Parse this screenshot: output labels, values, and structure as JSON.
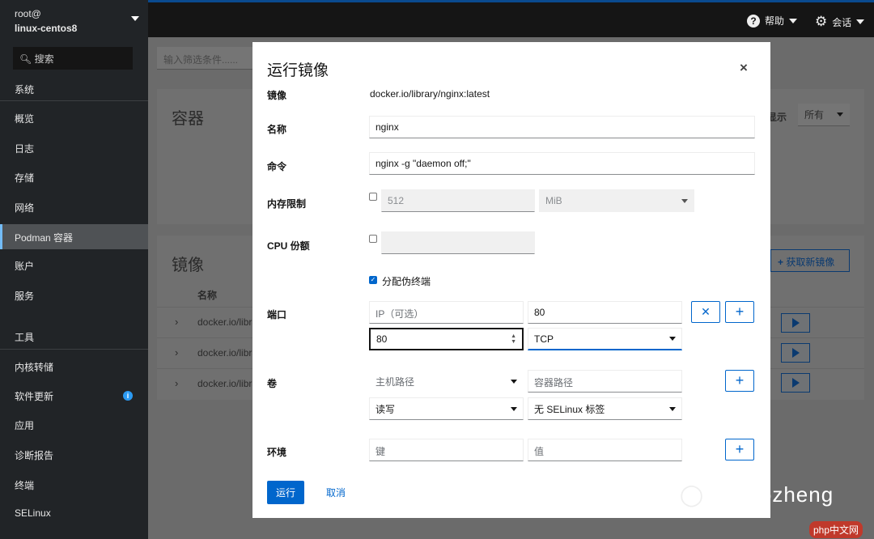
{
  "sidebar": {
    "user": "root@",
    "host": "linux-centos8",
    "search": "搜索",
    "section_system": "系统",
    "items_system": [
      "概览",
      "日志",
      "存储",
      "网络",
      "Podman 容器",
      "账户",
      "服务"
    ],
    "section_tools": "工具",
    "items_tools": [
      "内核转储",
      "软件更新",
      "应用",
      "诊断报告",
      "终端",
      "SELinux"
    ]
  },
  "topbar": {
    "help": "帮助",
    "session": "会话"
  },
  "background": {
    "filter_placeholder": "输入筛选条件......",
    "containers_title": "容器",
    "show_label": "显示",
    "show_value": "所有",
    "images_title": "镜像",
    "get_image": "获取新镜像",
    "name_header": "名称",
    "rows": [
      "docker.io/libra",
      "docker.io/libra",
      "docker.io/libra"
    ]
  },
  "modal": {
    "title": "运行镜像",
    "image_label": "镜像",
    "image_value": "docker.io/library/nginx:latest",
    "name_label": "名称",
    "name_value": "nginx",
    "command_label": "命令",
    "command_value": "nginx -g \"daemon off;\"",
    "memory_label": "内存限制",
    "memory_value": "512",
    "memory_unit": "MiB",
    "cpu_label": "CPU 份额",
    "tty_label": "分配伪终端",
    "ports_label": "端口",
    "ip_placeholder": "IP（可选）",
    "container_port": "80",
    "host_port": "80",
    "protocol": "TCP",
    "volumes_label": "卷",
    "host_path_placeholder": "主机路径",
    "container_path_placeholder": "容器路径",
    "mode": "读写",
    "selinux": "无 SELinux 标签",
    "env_label": "环境",
    "key_placeholder": "键",
    "value_placeholder": "值",
    "run": "运行",
    "cancel": "取消"
  },
  "watermark": {
    "text": "macrozheng",
    "logo": "php中文网"
  }
}
